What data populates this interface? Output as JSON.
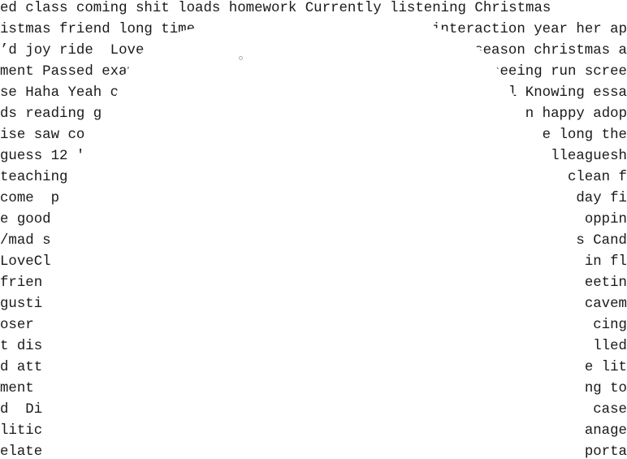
{
  "text_art": {
    "lines": [
      [
        "ed class coming shit loads homework Currently listening Christmas"
      ],
      [
        "istmas friend long time",
        "interaction year her ap"
      ],
      [
        "’d joy ride  Love ti",
        "season christmas a"
      ],
      [
        "ment Passed exam",
        "seeing run scree"
      ],
      [
        "se Haha Yeah c",
        "l Knowing essa"
      ],
      [
        "ds reading g",
        "n happy adop"
      ],
      [
        "ise saw co",
        "e long the"
      ],
      [
        "guess 12 '",
        "lleaguesh"
      ],
      [
        "teaching",
        "clean f"
      ],
      [
        "come  p",
        "day fi"
      ],
      [
        "e good",
        "oppin"
      ],
      [
        "/mad s",
        "s Cand"
      ],
      [
        "LoveCl",
        "in fl"
      ],
      [
        "frien",
        "eetin"
      ],
      [
        "gusti",
        "cavem"
      ],
      [
        "oser",
        "cing"
      ],
      [
        "t dis",
        "lled"
      ],
      [
        "d att",
        "e lit"
      ],
      [
        "ment",
        "ng to"
      ],
      [
        "d  Di",
        "case"
      ],
      [
        "litic",
        "anage"
      ],
      [
        "elate",
        "porta"
      ]
    ]
  },
  "colors": {
    "background": "#ffffff",
    "text": "#1a1a1a"
  }
}
